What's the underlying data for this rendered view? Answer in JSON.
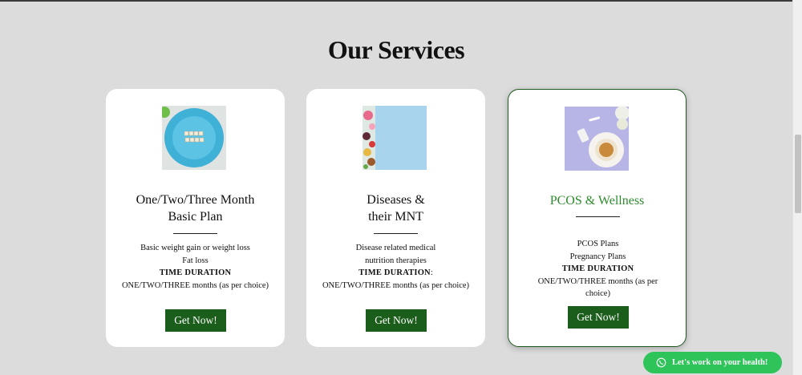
{
  "section": {
    "title": "Our Services"
  },
  "cards": [
    {
      "title_line1": "One/Two/Three Month",
      "title_line2": "Basic Plan",
      "desc_line1": "Basic weight gain or weight loss",
      "desc_line2": "Fat loss",
      "duration_label": "TIME DURATION",
      "duration_value": "ONE/TWO/THREE months (as per choice)",
      "button_label": "Get Now!",
      "image": "meal-plan-plate-image"
    },
    {
      "title_line1": "Diseases &",
      "title_line2": "their MNT",
      "desc_line1": "Disease related medical",
      "desc_line2": "nutrition therapies",
      "duration_label": "TIME DURATION",
      "duration_suffix": ":",
      "duration_value": "ONE/TWO/THREE months (as per choice)",
      "button_label": "Get Now!",
      "image": "fruits-flowers-image"
    },
    {
      "title_line1": "PCOS & Wellness",
      "desc_line1": "PCOS Plans",
      "desc_line2": "Pregnancy Plans",
      "duration_label": "TIME DURATION",
      "duration_value_line1": "ONE/TWO/THREE months (as per",
      "duration_value_line2": "choice)",
      "button_label": "Get Now!",
      "image": "breakfast-table-image"
    }
  ],
  "whatsapp": {
    "label": "Let's work on your health!",
    "icon": "whatsapp-icon"
  },
  "colors": {
    "accent": "#1b5e1b",
    "featured_title": "#2e8b2e",
    "whatsapp": "#2fc45a",
    "background": "#dcdcdc"
  }
}
